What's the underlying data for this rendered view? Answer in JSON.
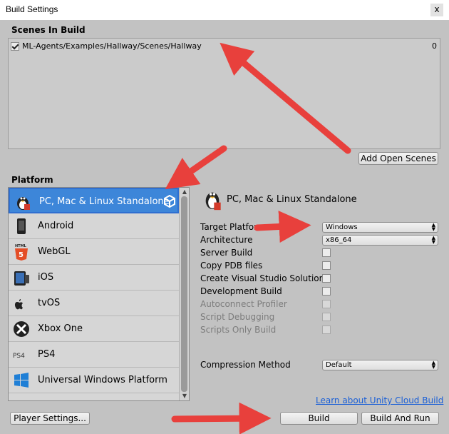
{
  "window": {
    "title": "Build Settings",
    "close_glyph": "x"
  },
  "scenes": {
    "label": "Scenes In Build",
    "items": [
      {
        "checked": true,
        "name": "ML-Agents/Examples/Hallway/Scenes/Hallway",
        "index": "0"
      }
    ],
    "add_open_scenes_label": "Add Open Scenes"
  },
  "platform": {
    "label": "Platform",
    "items": [
      {
        "label": "PC, Mac & Linux Standalone",
        "icon": "linux-penguin-icon",
        "selected": true
      },
      {
        "label": "Android",
        "icon": "android-phone-icon"
      },
      {
        "label": "WebGL",
        "icon": "html5-icon"
      },
      {
        "label": "iOS",
        "icon": "ios-device-icon"
      },
      {
        "label": "tvOS",
        "icon": "apple-tv-icon"
      },
      {
        "label": "Xbox One",
        "icon": "xbox-icon"
      },
      {
        "label": "PS4",
        "icon": "ps4-icon"
      },
      {
        "label": "Universal Windows Platform",
        "icon": "windows-icon"
      }
    ]
  },
  "settings": {
    "header_title": "PC, Mac & Linux Standalone",
    "target_platform": {
      "label": "Target Platform",
      "value": "Windows"
    },
    "architecture": {
      "label": "Architecture",
      "value": "x86_64"
    },
    "options": [
      {
        "label": "Server Build",
        "checked": false,
        "enabled": true
      },
      {
        "label": "Copy PDB files",
        "checked": false,
        "enabled": true
      },
      {
        "label": "Create Visual Studio Solution",
        "checked": false,
        "enabled": true
      },
      {
        "label": "Development Build",
        "checked": false,
        "enabled": true
      },
      {
        "label": "Autoconnect Profiler",
        "checked": false,
        "enabled": false
      },
      {
        "label": "Script Debugging",
        "checked": false,
        "enabled": false
      },
      {
        "label": "Scripts Only Build",
        "checked": false,
        "enabled": false
      }
    ],
    "compression": {
      "label": "Compression Method",
      "value": "Default"
    }
  },
  "footer": {
    "cloud_build_link": "Learn about Unity Cloud Build",
    "player_settings_label": "Player Settings...",
    "build_label": "Build",
    "build_and_run_label": "Build And Run"
  },
  "annotation_color": "#e8403c"
}
